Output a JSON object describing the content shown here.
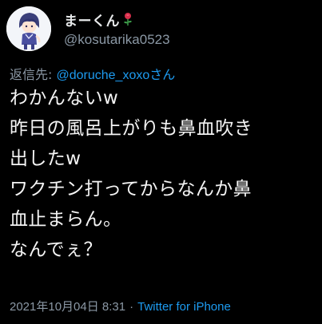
{
  "author": {
    "display_name": "まーくん",
    "name_emoji": "rose-emoji",
    "handle": "@kosutarika0523",
    "avatar": "anime-character-avatar"
  },
  "reply": {
    "prefix": "返信先: ",
    "mention": "@doruche_xoxo",
    "suffix": "さん"
  },
  "body_lines": [
    "わかんないw",
    "昨日の風呂上がりも鼻血吹き",
    "出したw",
    "ワクチン打ってからなんか鼻",
    "血止まらん。",
    "なんでぇ？"
  ],
  "meta": {
    "timestamp": "2021年10月04日 8:31",
    "separator": "·",
    "source": "Twitter for iPhone"
  },
  "colors": {
    "background": "#000000",
    "text": "#e7e9ea",
    "secondary": "#8b98a5",
    "link": "#1d9bf0"
  }
}
